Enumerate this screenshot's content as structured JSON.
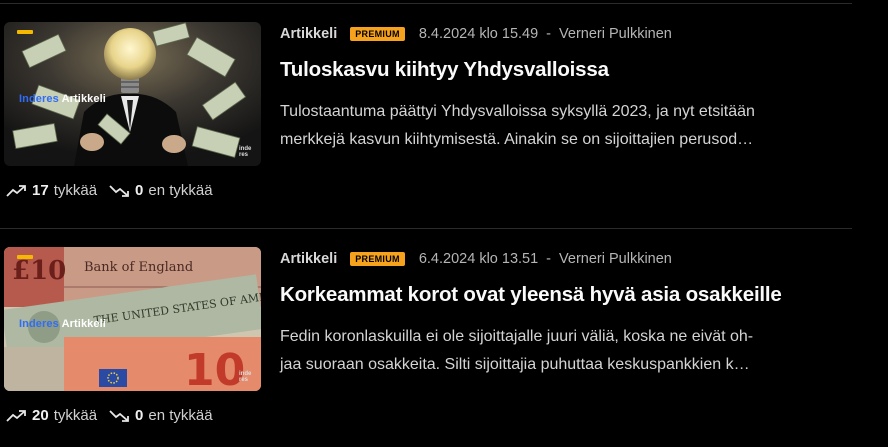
{
  "articles": [
    {
      "thumbnail": {
        "brand_part1": "Inderes",
        "brand_part2": "Artikkeli",
        "watermark": "inde res",
        "icon": "lightbulb-head-businessman-image"
      },
      "type": "Artikkeli",
      "badge": "PREMIUM",
      "date": "8.4.2024 klo 15.49",
      "separator": "-",
      "author": "Verneri Pulkkinen",
      "title": "Tuloskasvu kiihtyy Yhdysvalloissa",
      "excerpt_line1": "Tulostaantuma päättyi Yhdysvalloissa syksyllä 2023, ja nyt etsitään",
      "excerpt_line2": "merkkejä kasvun kiihtymisestä. Ainakin se on sijoittajien perusod…",
      "likes": {
        "count": "17",
        "label": "tykkää"
      },
      "dislikes": {
        "count": "0",
        "label": "en tykkää"
      }
    },
    {
      "thumbnail": {
        "brand_part1": "Inderes",
        "brand_part2": "Artikkeli",
        "watermark": "inde res",
        "icon": "banknotes-image"
      },
      "type": "Artikkeli",
      "badge": "PREMIUM",
      "date": "6.4.2024 klo 13.51",
      "separator": "-",
      "author": "Verneri Pulkkinen",
      "title": "Korkeammat korot ovat yleensä hyvä asia osakkeille",
      "excerpt_line1": "Fedin koronlaskuilla ei ole sijoittajalle juuri väliä, koska ne eivät oh-",
      "excerpt_line2": "jaa suoraan osakkeita. Silti sijoittajia puhuttaa keskuspankkien k…",
      "likes": {
        "count": "20",
        "label": "tykkää"
      },
      "dislikes": {
        "count": "0",
        "label": "en tykkää"
      }
    }
  ],
  "colors": {
    "background": "#000000",
    "accent_blue": "#2f6df6",
    "premium_badge": "#f7a21c"
  }
}
